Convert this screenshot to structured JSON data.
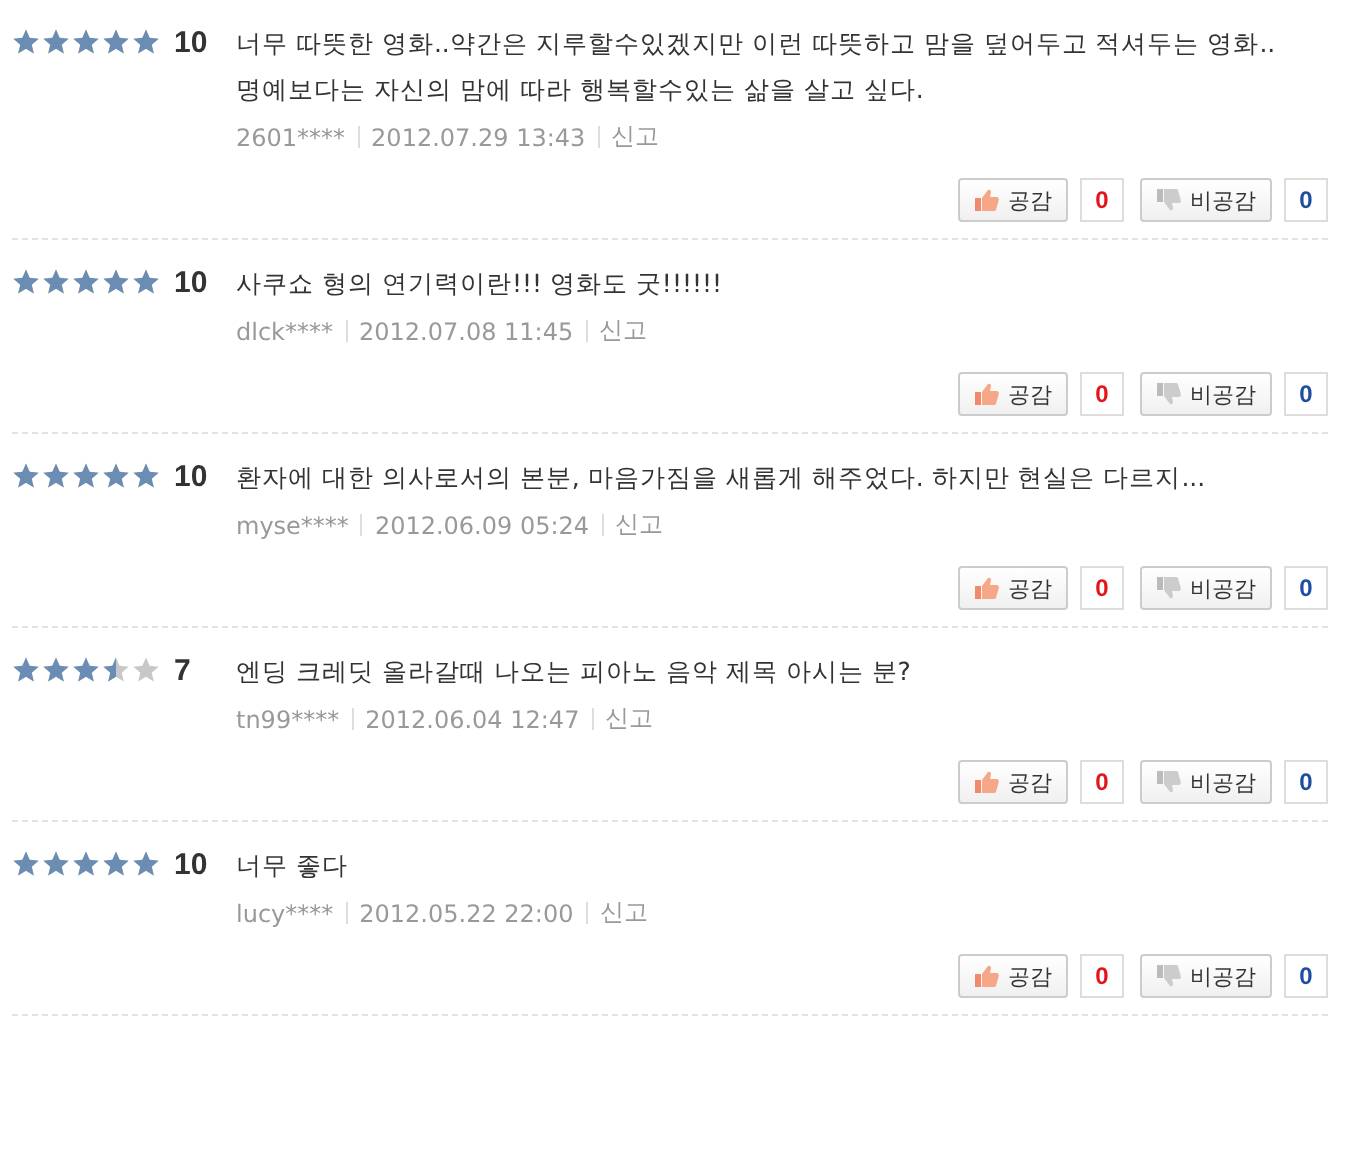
{
  "reviews": [
    {
      "stars": 5,
      "score": "10",
      "text": "너무 따뜻한 영화..약간은 지루할수있겠지만 이런 따뜻하고 맘을 덮어두고 적셔두는 영화..명예보다는 자신의 맘에 따라 행복할수있는 삶을 살고 싶다.",
      "user": "2601****",
      "date": "2012.07.29 13:43",
      "report": "신고",
      "like_label": "공감",
      "like_count": "0",
      "dislike_label": "비공감",
      "dislike_count": "0"
    },
    {
      "stars": 5,
      "score": "10",
      "text": "사쿠쇼 형의 연기력이란!!! 영화도 굿!!!!!!",
      "user": "dlck****",
      "date": "2012.07.08 11:45",
      "report": "신고",
      "like_label": "공감",
      "like_count": "0",
      "dislike_label": "비공감",
      "dislike_count": "0"
    },
    {
      "stars": 5,
      "score": "10",
      "text": "환자에 대한 의사로서의 본분, 마음가짐을 새롭게 해주었다. 하지만 현실은 다르지...",
      "user": "myse****",
      "date": "2012.06.09 05:24",
      "report": "신고",
      "like_label": "공감",
      "like_count": "0",
      "dislike_label": "비공감",
      "dislike_count": "0"
    },
    {
      "stars": 3.5,
      "score": "7",
      "text": "엔딩 크레딧 올라갈때 나오는 피아노 음악 제목 아시는 분?",
      "user": "tn99****",
      "date": "2012.06.04 12:47",
      "report": "신고",
      "like_label": "공감",
      "like_count": "0",
      "dislike_label": "비공감",
      "dislike_count": "0"
    },
    {
      "stars": 5,
      "score": "10",
      "text": "너무 좋다",
      "user": "lucy****",
      "date": "2012.05.22 22:00",
      "report": "신고",
      "like_label": "공감",
      "like_count": "0",
      "dislike_label": "비공감",
      "dislike_count": "0"
    }
  ]
}
